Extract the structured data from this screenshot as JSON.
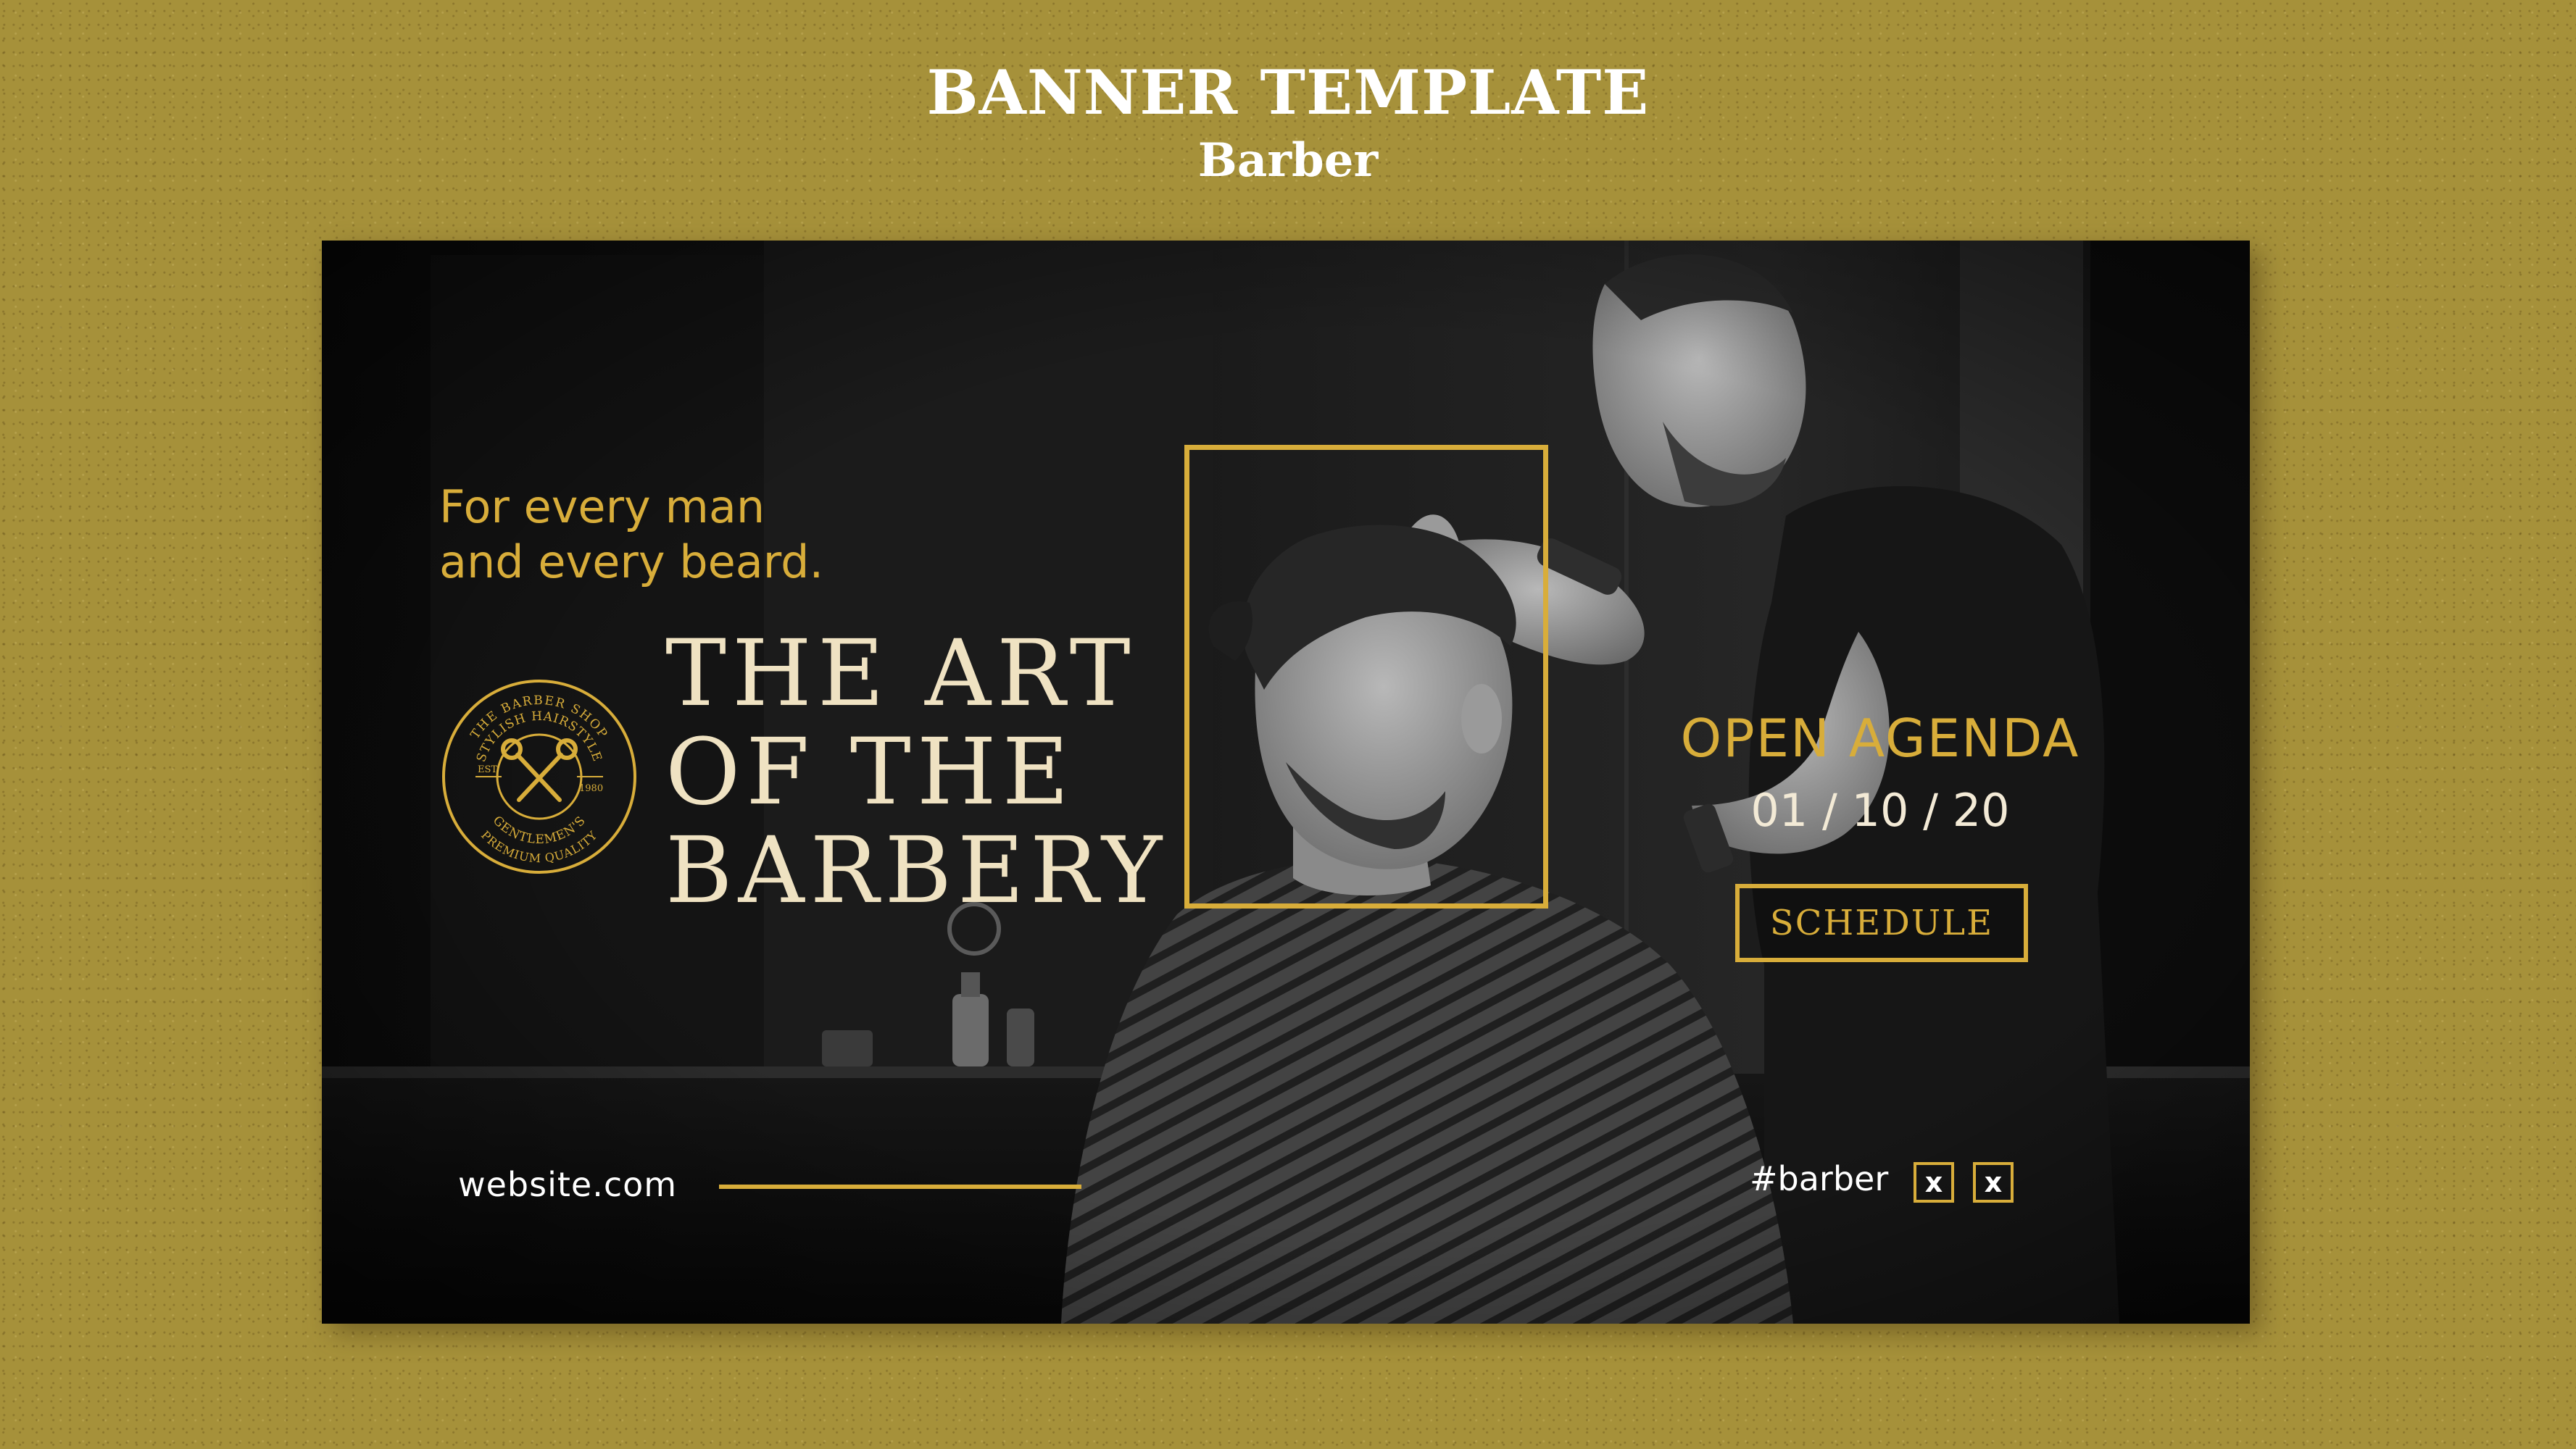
{
  "page": {
    "title": "BANNER TEMPLATE",
    "subtitle": "Barber"
  },
  "banner": {
    "tagline_line1": "For every man",
    "tagline_line2": "and every beard.",
    "headline_line1": "THE ART",
    "headline_line2": "OF THE",
    "headline_line3": "BARBERY",
    "badge": {
      "top_text": "THE BARBER SHOP",
      "inner_text": "STYLISH HAIRSTYLE",
      "bottom_text": "GENTLEMEN'S",
      "bottom_text2": "PREMIUM QUALITY",
      "est": "EST.",
      "year": "1980"
    },
    "open_agenda": "OPEN AGENDA",
    "date": "01 / 10 / 20",
    "schedule_label": "SCHEDULE",
    "website": "website.com",
    "hashtag": "#barber",
    "social_1": "x",
    "social_2": "x"
  },
  "colors": {
    "background": "#a6913a",
    "accent_gold": "#d8ad3a",
    "banner_dark": "#0f0f0f"
  },
  "icons": {
    "badge": "scissors-icon",
    "social": [
      "x-icon",
      "x-icon"
    ]
  }
}
